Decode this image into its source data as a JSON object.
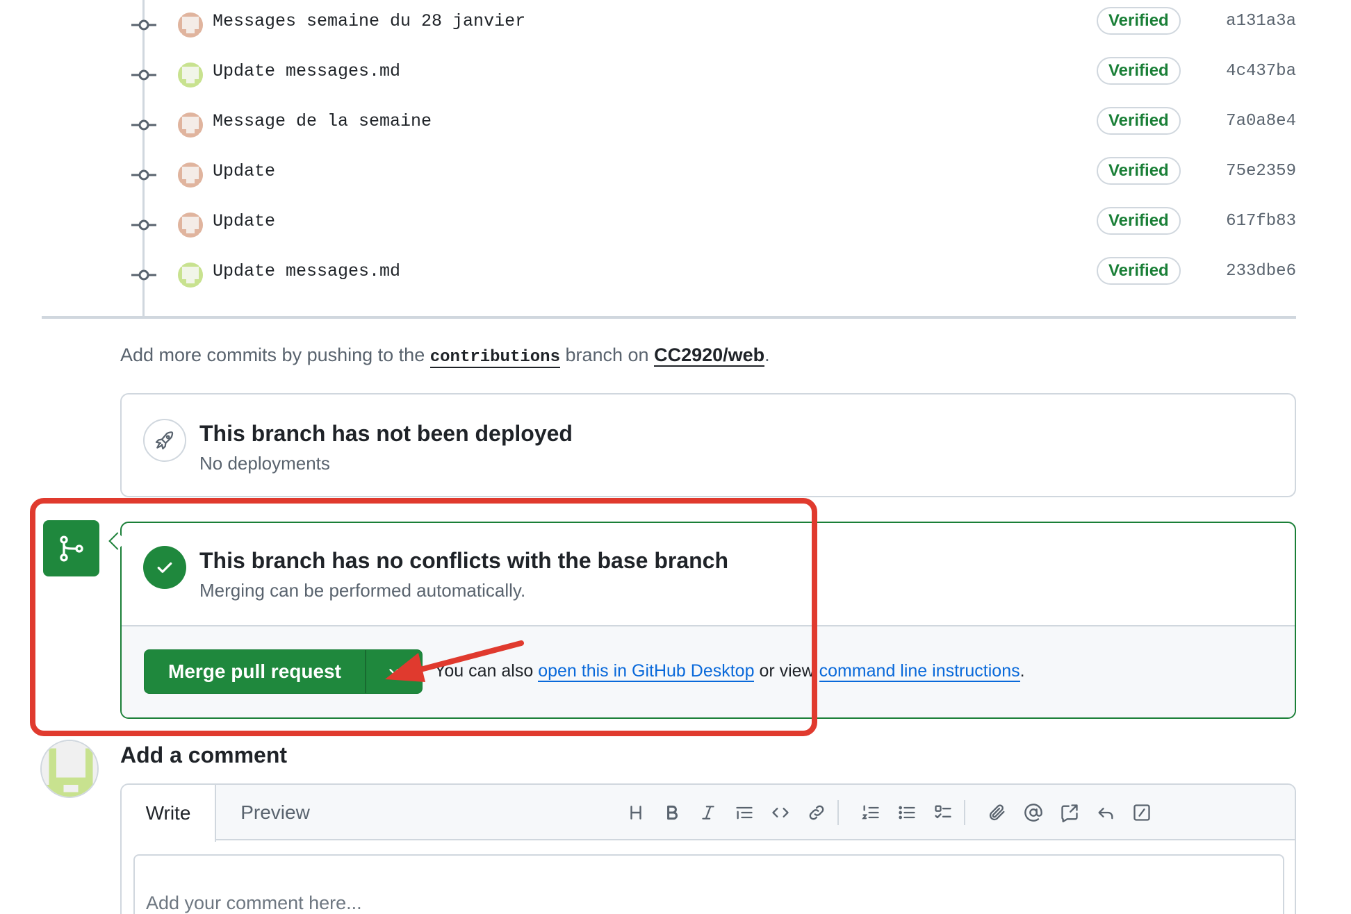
{
  "commits": [
    {
      "message": "Messages semaine du 28 janvier",
      "badge": "Verified",
      "sha": "a131a3a",
      "avatar": "orange"
    },
    {
      "message": "Update messages.md",
      "badge": "Verified",
      "sha": "4c437ba",
      "avatar": "green"
    },
    {
      "message": "Message de la semaine",
      "badge": "Verified",
      "sha": "7a0a8e4",
      "avatar": "orange"
    },
    {
      "message": "Update",
      "badge": "Verified",
      "sha": "75e2359",
      "avatar": "orange"
    },
    {
      "message": "Update",
      "badge": "Verified",
      "sha": "617fb83",
      "avatar": "orange"
    },
    {
      "message": "Update messages.md",
      "badge": "Verified",
      "sha": "233dbe6",
      "avatar": "green"
    }
  ],
  "more_commits": {
    "prefix": "Add more commits by pushing to the",
    "branch": "contributions",
    "middle": "branch on",
    "repo": "CC2920/web",
    "suffix": "."
  },
  "deploy": {
    "icon": "rocket-icon",
    "title": "This branch has not been deployed",
    "subtitle": "No deployments"
  },
  "merge": {
    "icon": "git-branch-icon",
    "status_icon": "check-icon",
    "title": "This branch has no conflicts with the base branch",
    "subtitle": "Merging can be performed automatically.",
    "button_label": "Merge pull request",
    "hint_prefix": "You can also",
    "desktop_link": "open this in GitHub Desktop",
    "hint_middle": "or view",
    "cli_link": "command line instructions",
    "hint_suffix": "."
  },
  "comment": {
    "heading": "Add a comment",
    "tabs": [
      "Write",
      "Preview"
    ],
    "placeholder": "Add your comment here...",
    "toolbar": [
      "heading-icon",
      "bold-icon",
      "italic-icon",
      "quote-icon",
      "code-icon",
      "link-icon",
      "ordered-list-icon",
      "unordered-list-icon",
      "task-list-icon",
      "attach-icon",
      "mention-icon",
      "reference-icon",
      "reply-icon",
      "slash-command-icon"
    ]
  },
  "colors": {
    "accent_green": "#1f883d",
    "verified_green": "#1a7f37",
    "link_blue": "#0969da",
    "highlight_red": "#e03a2e"
  }
}
